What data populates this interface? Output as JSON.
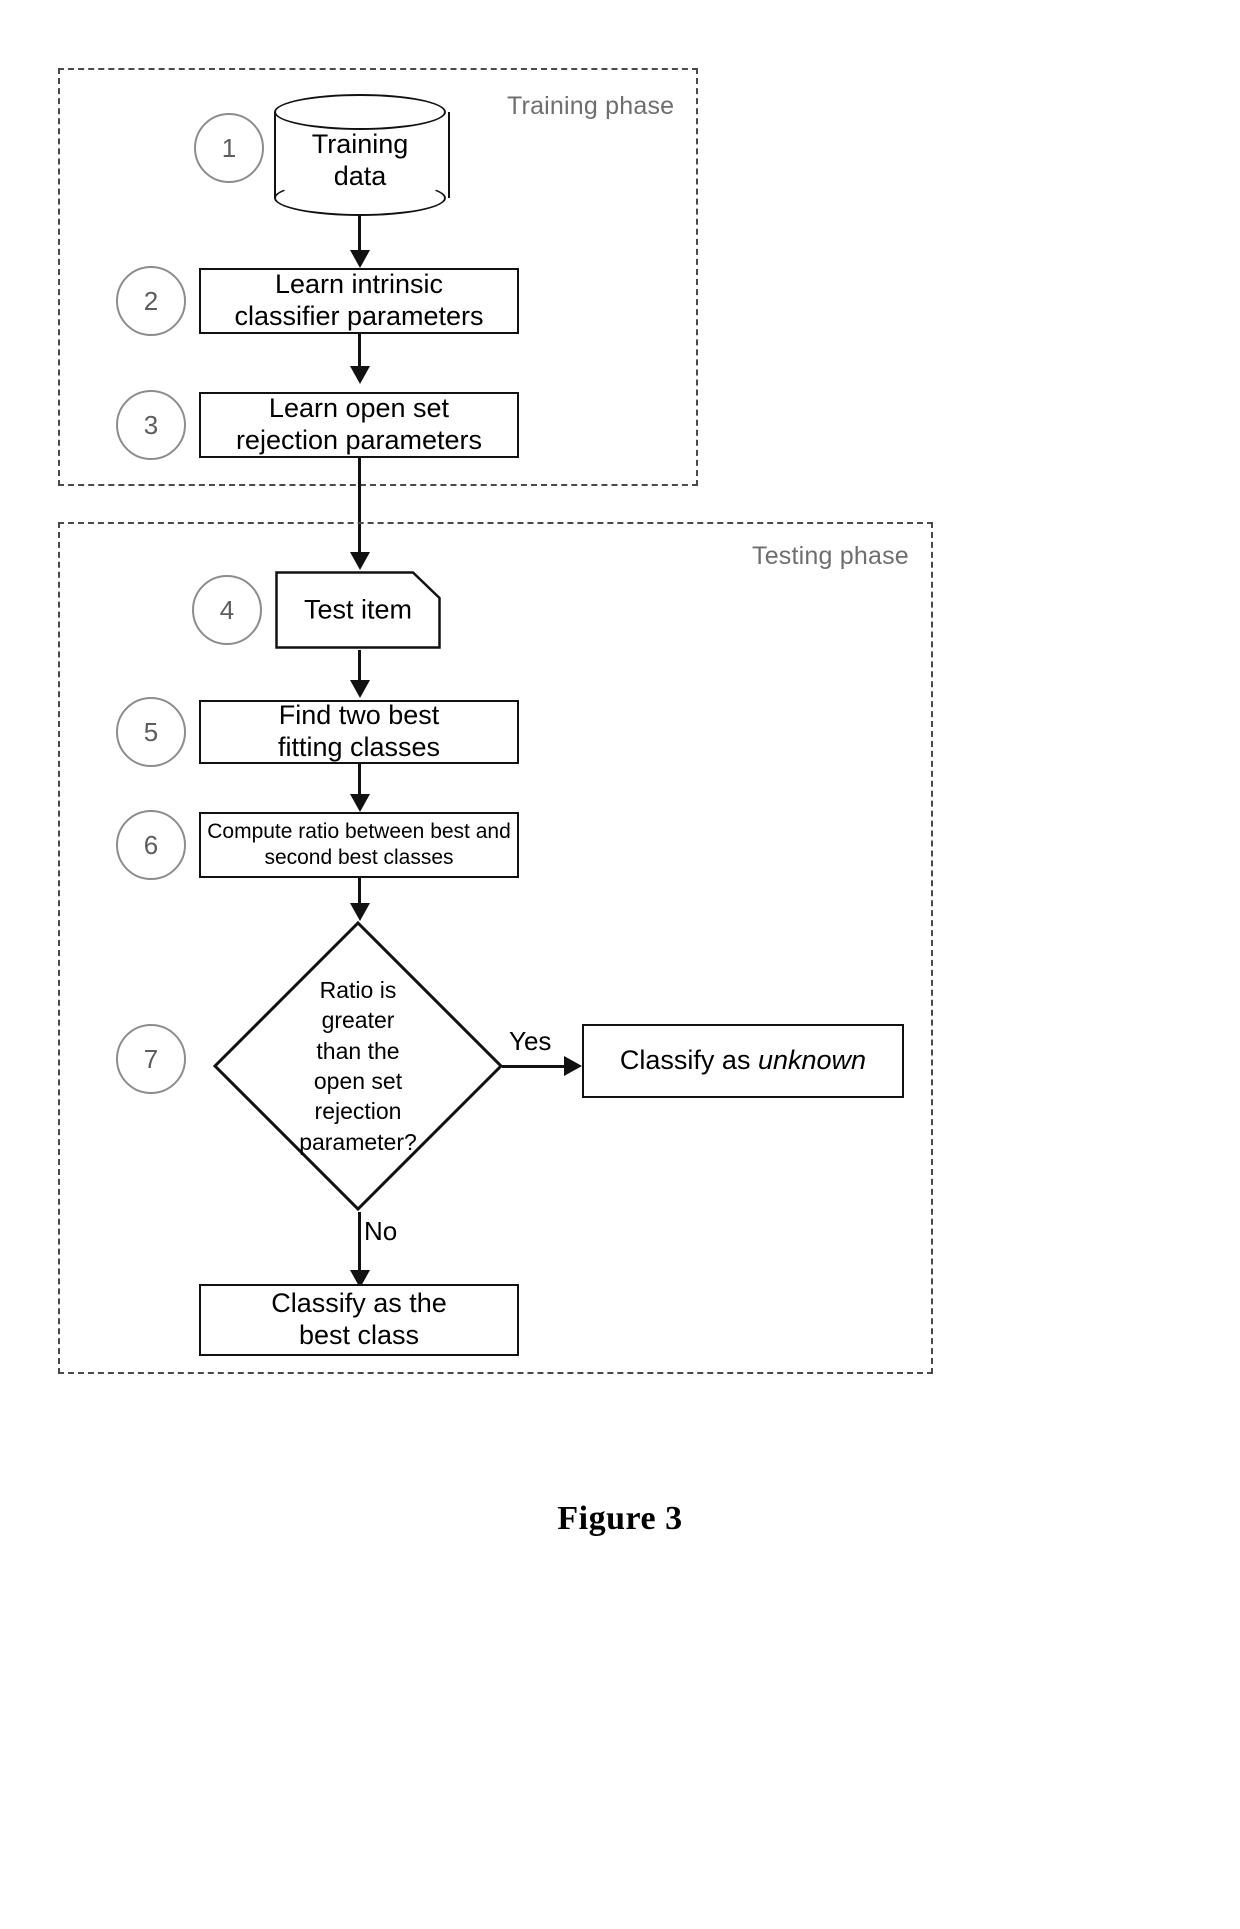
{
  "figure": {
    "caption": "Figure 3",
    "phases": [
      {
        "id": "training",
        "label": "Training phase"
      },
      {
        "id": "testing",
        "label": "Testing phase"
      }
    ],
    "steps": [
      {
        "number": "1",
        "shape": "cylinder",
        "text_line1": "Training",
        "text_line2": "data"
      },
      {
        "number": "2",
        "shape": "process",
        "text_line1": "Learn intrinsic",
        "text_line2": "classifier parameters"
      },
      {
        "number": "3",
        "shape": "process",
        "text_line1": "Learn open set",
        "text_line2": "rejection parameters"
      },
      {
        "number": "4",
        "shape": "document",
        "text_line1": "Test item",
        "text_line2": ""
      },
      {
        "number": "5",
        "shape": "process",
        "text_line1": "Find two best",
        "text_line2": "fitting classes"
      },
      {
        "number": "6",
        "shape": "process",
        "text_line1": "Compute ratio between best and",
        "text_line2": "second best classes"
      },
      {
        "number": "7",
        "shape": "decision",
        "text_line1": "Ratio is",
        "text_line2": "greater",
        "text_line3": "than the",
        "text_line4": "open set",
        "text_line5": "rejection",
        "text_line6": "parameter?"
      }
    ],
    "branches": [
      {
        "id": "yes",
        "label": "Yes"
      },
      {
        "id": "no",
        "label": "No"
      }
    ],
    "terminals": [
      {
        "id": "unknown",
        "prefix": "Classify as ",
        "emphasis": "unknown",
        "suffix": ""
      },
      {
        "id": "bestclass",
        "text_line1": "Classify as the",
        "text_line2": "best class"
      }
    ],
    "colors": {
      "stroke": "#111111",
      "dashed_border": "#4a4a4a",
      "phase_label": "#6e6e6e",
      "step_circle": "#8d8d8d",
      "background": "#ffffff"
    }
  }
}
